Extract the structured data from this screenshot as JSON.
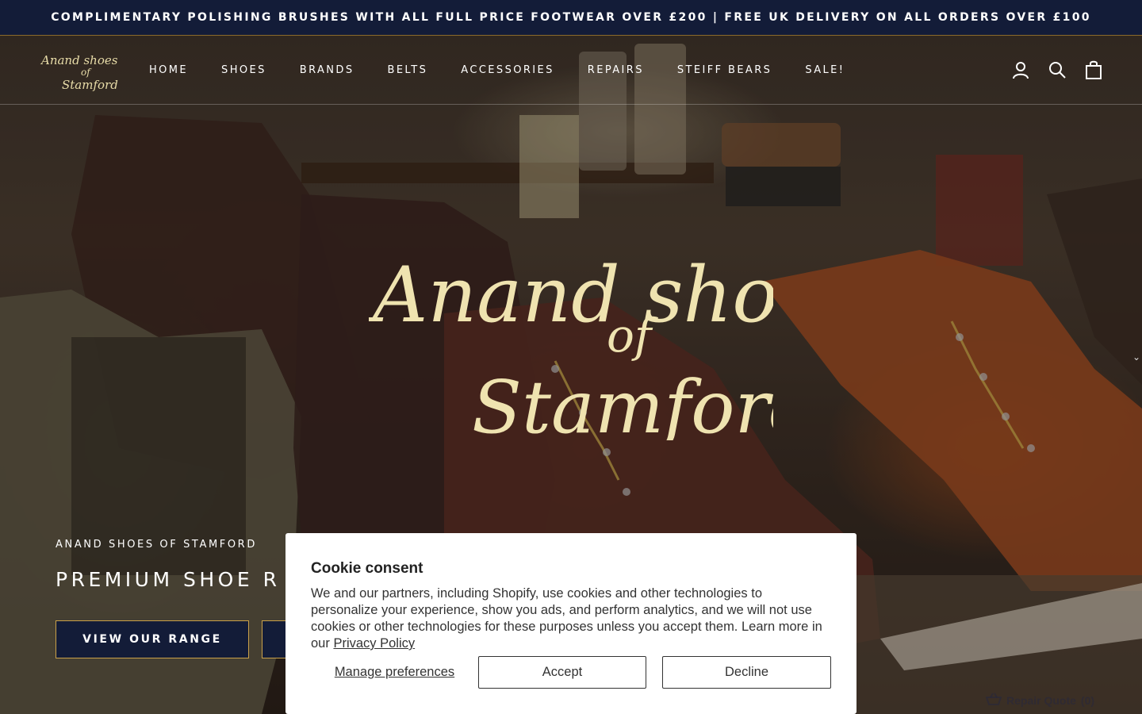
{
  "announcement": {
    "text": "COMPLIMENTARY POLISHING BRUSHES WITH ALL FULL PRICE FOOTWEAR OVER £200 | FREE UK DELIVERY ON ALL ORDERS OVER £100"
  },
  "brand": {
    "logo_line1": "Anand shoes",
    "logo_line2": "of",
    "logo_line3": "Stamford",
    "accent_color": "#131c38",
    "gold_color": "#c9a04a"
  },
  "nav": {
    "items": [
      {
        "label": "HOME"
      },
      {
        "label": "SHOES"
      },
      {
        "label": "BRANDS"
      },
      {
        "label": "BELTS"
      },
      {
        "label": "ACCESSORIES"
      },
      {
        "label": "REPAIRS"
      },
      {
        "label": "STEIFF BEARS"
      },
      {
        "label": "SALE!"
      }
    ]
  },
  "header_icons": [
    "account-icon",
    "search-icon",
    "bag-icon"
  ],
  "hero": {
    "subtitle": "ANAND SHOES OF STAMFORD",
    "title": "PREMIUM SHOE R",
    "primary_button": "VIEW OUR RANGE"
  },
  "repair_quote": {
    "label": "Repair Quote",
    "count": "(0)"
  },
  "cookie": {
    "title": "Cookie consent",
    "body": "We and our partners, including Shopify, use cookies and other technologies to personalize your experience, show you ads, and perform analytics, and we will not use cookies or other technologies for these purposes unless you accept them. Learn more in our ",
    "privacy_link": "Privacy Policy",
    "manage_label": "Manage preferences",
    "accept_label": "Accept",
    "decline_label": "Decline"
  }
}
